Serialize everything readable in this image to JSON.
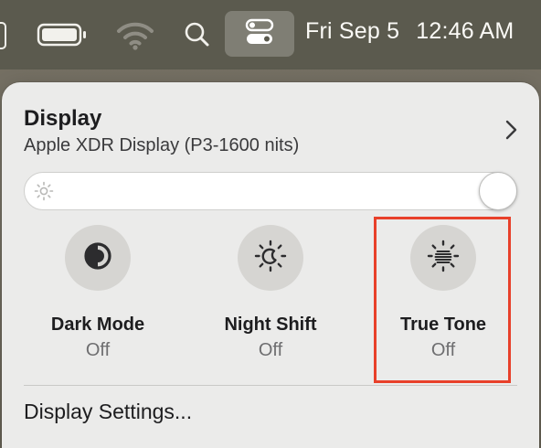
{
  "menubar": {
    "date": "Fri Sep 5",
    "time": "12:46 AM",
    "icons": [
      "battery-icon",
      "wifi-icon",
      "spotlight-search-icon",
      "control-center-icon"
    ]
  },
  "panel": {
    "title": "Display",
    "subtitle": "Apple XDR Display (P3-1600 nits)",
    "brightness": 1.0,
    "tiles": [
      {
        "label": "Dark Mode",
        "state": "Off",
        "icon": "dark-mode-icon"
      },
      {
        "label": "Night Shift",
        "state": "Off",
        "icon": "night-shift-icon"
      },
      {
        "label": "True Tone",
        "state": "Off",
        "icon": "true-tone-icon"
      }
    ],
    "settings_link": "Display Settings..."
  },
  "colors": {
    "highlight": "#e8402a",
    "panel": "#ebebea",
    "menubar": "#5b5a4e"
  }
}
